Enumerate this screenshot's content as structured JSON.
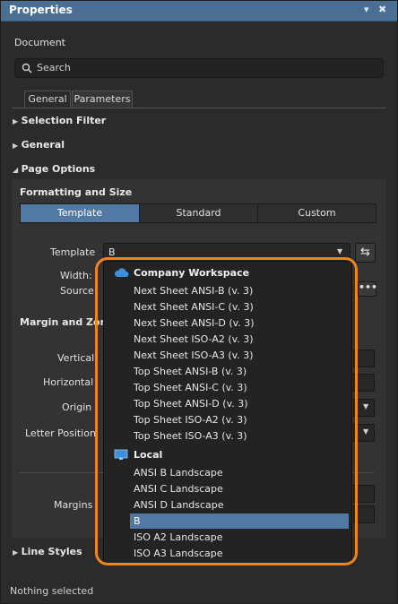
{
  "panel": {
    "title": "Properties",
    "pin_glyph": "▾",
    "close_glyph": "✖",
    "context": "Document",
    "status": "Nothing selected"
  },
  "search": {
    "placeholder": "Search"
  },
  "tabs": [
    {
      "label": "General",
      "active": true
    },
    {
      "label": "Parameters",
      "active": false
    }
  ],
  "sections": {
    "selection_filter": "Selection Filter",
    "general": "General",
    "page_options": "Page Options",
    "formatting_and_size": "Formatting and Size",
    "margin_and_zones": "Margin and Zone",
    "line_styles": "Line Styles"
  },
  "format_mode": {
    "options": [
      "Template",
      "Standard",
      "Custom"
    ],
    "selected": "Template"
  },
  "fields": {
    "template_label": "Template",
    "template_value": "B",
    "width_label": "Width:",
    "source_label": "Source",
    "vertical_label": "Vertical",
    "horizontal_label": "Horizontal",
    "origin_label": "Origin",
    "letter_position_label": "Letter Position",
    "margins_label": "Margins"
  },
  "template_dropdown": {
    "groups": [
      {
        "name": "Company Workspace",
        "icon": "cloud-icon",
        "items": [
          "Next Sheet ANSI-B (v. 3)",
          "Next Sheet ANSI-C (v. 3)",
          "Next Sheet ANSI-D (v. 3)",
          "Next Sheet ISO-A2 (v. 3)",
          "Next Sheet ISO-A3 (v. 3)",
          "Top Sheet ANSI-B (v. 3)",
          "Top Sheet ANSI-C (v. 3)",
          "Top Sheet ANSI-D (v. 3)",
          "Top Sheet ISO-A2 (v. 3)",
          "Top Sheet ISO-A3 (v. 3)"
        ]
      },
      {
        "name": "Local",
        "icon": "monitor-icon",
        "items": [
          "ANSI B Landscape",
          "ANSI C Landscape",
          "ANSI D Landscape",
          "B",
          "ISO A2 Landscape",
          "ISO A3 Landscape"
        ]
      }
    ],
    "selected": "B"
  },
  "colors": {
    "accent": "#5278a4",
    "highlight_ring": "#f0851b",
    "title_bar": "#4b6e93"
  }
}
